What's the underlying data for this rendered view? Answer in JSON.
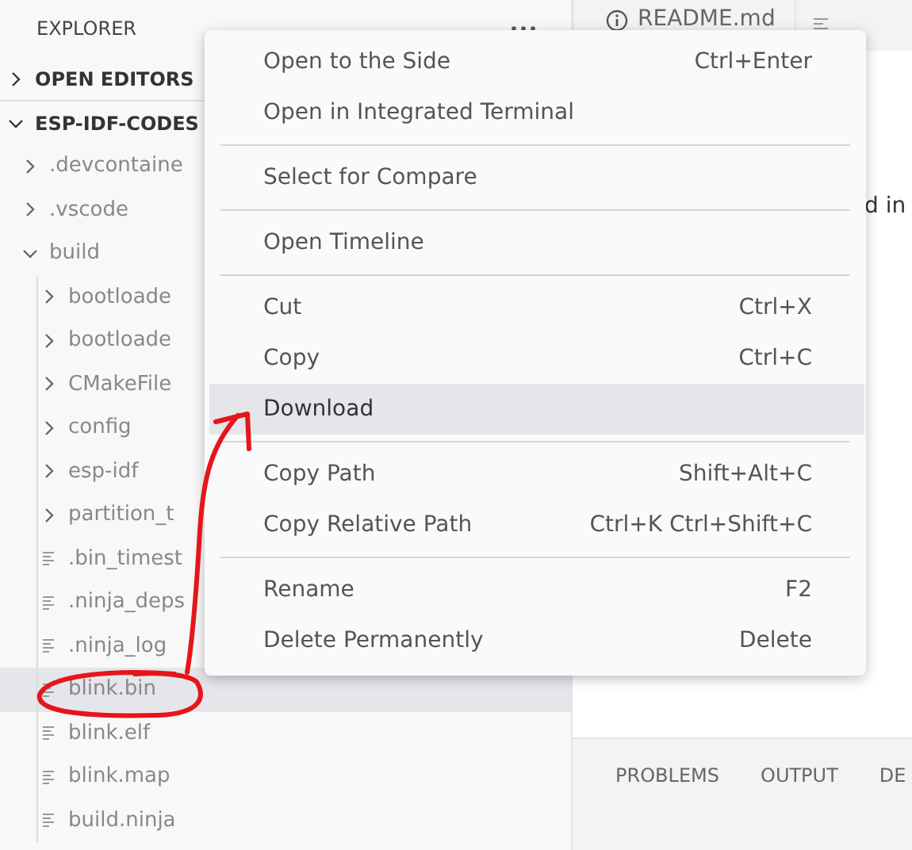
{
  "sidebar": {
    "title": "EXPLORER",
    "sections": [
      {
        "label": "OPEN EDITORS",
        "expanded": false
      },
      {
        "label": "ESP-IDF-CODES",
        "expanded": true,
        "children": [
          {
            "label": ".devcontaine",
            "kind": "folder",
            "expanded": false,
            "selected": false
          },
          {
            "label": ".vscode",
            "kind": "folder",
            "expanded": false,
            "selected": false
          },
          {
            "label": "build",
            "kind": "folder",
            "expanded": true,
            "selected": false,
            "children": [
              {
                "label": "bootloade",
                "kind": "folder",
                "expanded": false,
                "selected": false
              },
              {
                "label": "bootloade",
                "kind": "folder",
                "expanded": false,
                "selected": false
              },
              {
                "label": "CMakeFile",
                "kind": "folder",
                "expanded": false,
                "selected": false
              },
              {
                "label": "config",
                "kind": "folder",
                "expanded": false,
                "selected": false
              },
              {
                "label": "esp-idf",
                "kind": "folder",
                "expanded": false,
                "selected": false
              },
              {
                "label": "partition_t",
                "kind": "folder",
                "expanded": false,
                "selected": false
              },
              {
                "label": ".bin_timest",
                "kind": "file",
                "selected": false
              },
              {
                "label": ".ninja_deps",
                "kind": "file",
                "selected": false
              },
              {
                "label": ".ninja_log",
                "kind": "file",
                "selected": false
              },
              {
                "label": "blink.bin",
                "kind": "file",
                "selected": true
              },
              {
                "label": "blink.elf",
                "kind": "file",
                "selected": false
              },
              {
                "label": "blink.map",
                "kind": "file",
                "selected": false
              },
              {
                "label": "build.ninja",
                "kind": "file",
                "selected": false
              }
            ]
          }
        ]
      }
    ]
  },
  "editor": {
    "tab": {
      "label": "README.md"
    },
    "text": "d in",
    "panel_tabs": [
      "PROBLEMS",
      "OUTPUT",
      "DE"
    ]
  },
  "context_menu": {
    "groups": [
      [
        {
          "label": "Open to the Side",
          "shortcut": "Ctrl+Enter",
          "selected": false
        },
        {
          "label": "Open in Integrated Terminal",
          "selected": false
        }
      ],
      [
        {
          "label": "Select for Compare",
          "selected": false
        }
      ],
      [
        {
          "label": "Open Timeline",
          "selected": false
        }
      ],
      [
        {
          "label": "Cut",
          "shortcut": "Ctrl+X",
          "selected": false
        },
        {
          "label": "Copy",
          "shortcut": "Ctrl+C",
          "selected": false
        },
        {
          "label": "Download",
          "selected": true
        }
      ],
      [
        {
          "label": "Copy Path",
          "shortcut": "Shift+Alt+C",
          "selected": false
        },
        {
          "label": "Copy Relative Path",
          "shortcut": "Ctrl+K Ctrl+Shift+C",
          "selected": false
        }
      ],
      [
        {
          "label": "Rename",
          "shortcut": "F2",
          "selected": false
        },
        {
          "label": "Delete Permanently",
          "shortcut": "Delete",
          "selected": false
        }
      ]
    ]
  }
}
